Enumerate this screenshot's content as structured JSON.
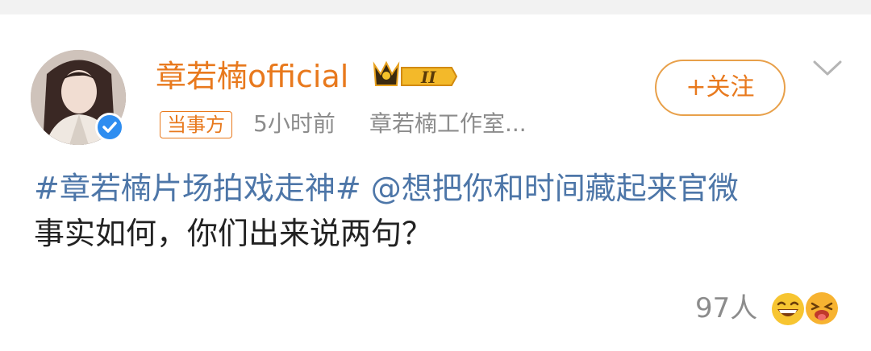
{
  "post": {
    "author": {
      "name": "章若楠official",
      "verified": true,
      "vip_level": "II",
      "badge": "当事方",
      "time": "5小时前",
      "source": "章若楠工作室..."
    },
    "follow_label": "+关注",
    "text": {
      "topic": "#章若楠片场拍戏走神#",
      "mention": "@想把你和时间藏起来官微",
      "body": "事实如何，你们出来说两句？"
    },
    "reactions": {
      "count_label": "97人"
    }
  },
  "colors": {
    "accent": "#e8791d",
    "link": "#4d76a8",
    "muted": "#8c8c8c",
    "verified": "#2e8df0"
  },
  "icons": [
    "verified-icon",
    "vip-crown-icon",
    "chevron-down-icon",
    "laugh-emoji-icon",
    "laugh-tongue-emoji-icon"
  ]
}
